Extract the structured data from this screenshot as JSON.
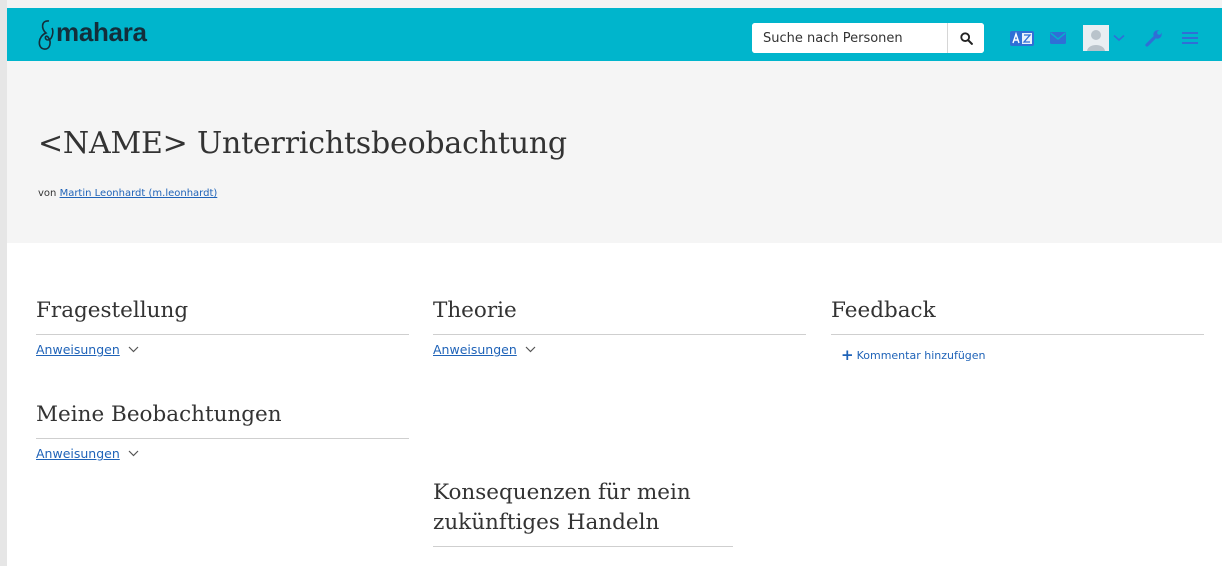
{
  "header": {
    "logo_text": "mahara",
    "search_placeholder": "Suche nach Personen",
    "icons": [
      "search-icon",
      "language-icon",
      "mail-icon",
      "avatar",
      "chevron-down-icon",
      "wrench-icon",
      "menu-icon"
    ],
    "colors": {
      "bar": "#00b5cc",
      "logo_text": "#132e3b",
      "icons": "#2f6fd6"
    }
  },
  "page": {
    "title": "<NAME> Unterrichtsbeobachtung",
    "byline_prefix": "von",
    "author": "Martin Leonhardt (m.leonhardt)"
  },
  "blocks": [
    {
      "title": "Fragestellung",
      "toggle": "Anweisungen"
    },
    {
      "title": "Meine Beobachtungen",
      "toggle": "Anweisungen"
    },
    {
      "title": "Theorie",
      "toggle": "Anweisungen"
    },
    {
      "title": "Konsequenzen für mein zukünftiges Handeln"
    },
    {
      "title": "Feedback",
      "action": "Kommentar hinzufügen"
    }
  ],
  "colors": {
    "link": "#1f63b8",
    "band": "#f5f5f5",
    "text": "#333333"
  }
}
